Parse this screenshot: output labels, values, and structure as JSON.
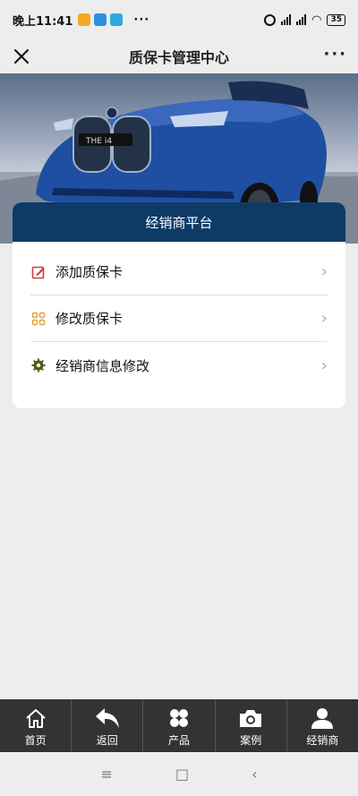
{
  "status": {
    "time": "晚上11:41",
    "dots": "···",
    "battery": "35"
  },
  "header": {
    "title": "质保卡管理中心",
    "more": "···"
  },
  "card": {
    "title": "经销商平台",
    "items": [
      {
        "label": "添加质保卡",
        "icon": "edit-icon",
        "color": "#d23a3a"
      },
      {
        "label": "修改质保卡",
        "icon": "grid-icon",
        "color": "#e2a32e"
      },
      {
        "label": "经销商信息修改",
        "icon": "gear-icon",
        "color": "#555a12"
      }
    ]
  },
  "tabs": [
    {
      "label": "首页",
      "icon": "home-icon"
    },
    {
      "label": "返回",
      "icon": "back-arrow-icon"
    },
    {
      "label": "产品",
      "icon": "products-icon"
    },
    {
      "label": "案例",
      "icon": "camera-icon"
    },
    {
      "label": "经销商",
      "icon": "user-icon"
    }
  ],
  "nav": {
    "menu": "≡",
    "home": "□",
    "back": "‹"
  },
  "colors": {
    "card_header": "#0d3b66",
    "tabbar": "#333333",
    "background": "#ededed"
  }
}
